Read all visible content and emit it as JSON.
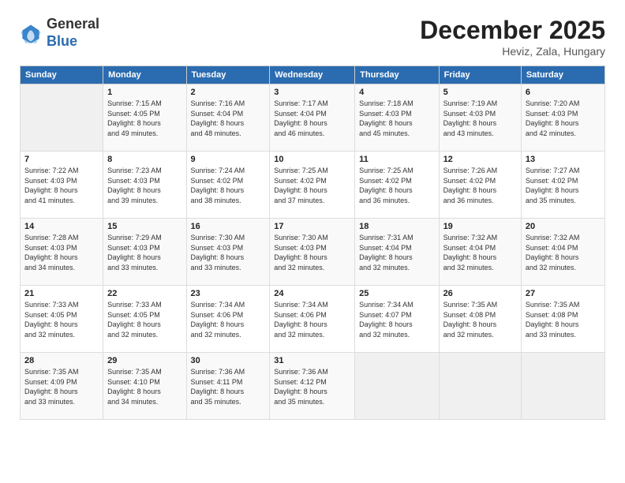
{
  "header": {
    "logo_line1": "General",
    "logo_line2": "Blue",
    "month": "December 2025",
    "location": "Heviz, Zala, Hungary"
  },
  "columns": [
    "Sunday",
    "Monday",
    "Tuesday",
    "Wednesday",
    "Thursday",
    "Friday",
    "Saturday"
  ],
  "weeks": [
    [
      {
        "day": "",
        "info": ""
      },
      {
        "day": "1",
        "info": "Sunrise: 7:15 AM\nSunset: 4:05 PM\nDaylight: 8 hours\nand 49 minutes."
      },
      {
        "day": "2",
        "info": "Sunrise: 7:16 AM\nSunset: 4:04 PM\nDaylight: 8 hours\nand 48 minutes."
      },
      {
        "day": "3",
        "info": "Sunrise: 7:17 AM\nSunset: 4:04 PM\nDaylight: 8 hours\nand 46 minutes."
      },
      {
        "day": "4",
        "info": "Sunrise: 7:18 AM\nSunset: 4:03 PM\nDaylight: 8 hours\nand 45 minutes."
      },
      {
        "day": "5",
        "info": "Sunrise: 7:19 AM\nSunset: 4:03 PM\nDaylight: 8 hours\nand 43 minutes."
      },
      {
        "day": "6",
        "info": "Sunrise: 7:20 AM\nSunset: 4:03 PM\nDaylight: 8 hours\nand 42 minutes."
      }
    ],
    [
      {
        "day": "7",
        "info": "Sunrise: 7:22 AM\nSunset: 4:03 PM\nDaylight: 8 hours\nand 41 minutes."
      },
      {
        "day": "8",
        "info": "Sunrise: 7:23 AM\nSunset: 4:03 PM\nDaylight: 8 hours\nand 39 minutes."
      },
      {
        "day": "9",
        "info": "Sunrise: 7:24 AM\nSunset: 4:02 PM\nDaylight: 8 hours\nand 38 minutes."
      },
      {
        "day": "10",
        "info": "Sunrise: 7:25 AM\nSunset: 4:02 PM\nDaylight: 8 hours\nand 37 minutes."
      },
      {
        "day": "11",
        "info": "Sunrise: 7:25 AM\nSunset: 4:02 PM\nDaylight: 8 hours\nand 36 minutes."
      },
      {
        "day": "12",
        "info": "Sunrise: 7:26 AM\nSunset: 4:02 PM\nDaylight: 8 hours\nand 36 minutes."
      },
      {
        "day": "13",
        "info": "Sunrise: 7:27 AM\nSunset: 4:02 PM\nDaylight: 8 hours\nand 35 minutes."
      }
    ],
    [
      {
        "day": "14",
        "info": "Sunrise: 7:28 AM\nSunset: 4:03 PM\nDaylight: 8 hours\nand 34 minutes."
      },
      {
        "day": "15",
        "info": "Sunrise: 7:29 AM\nSunset: 4:03 PM\nDaylight: 8 hours\nand 33 minutes."
      },
      {
        "day": "16",
        "info": "Sunrise: 7:30 AM\nSunset: 4:03 PM\nDaylight: 8 hours\nand 33 minutes."
      },
      {
        "day": "17",
        "info": "Sunrise: 7:30 AM\nSunset: 4:03 PM\nDaylight: 8 hours\nand 32 minutes."
      },
      {
        "day": "18",
        "info": "Sunrise: 7:31 AM\nSunset: 4:04 PM\nDaylight: 8 hours\nand 32 minutes."
      },
      {
        "day": "19",
        "info": "Sunrise: 7:32 AM\nSunset: 4:04 PM\nDaylight: 8 hours\nand 32 minutes."
      },
      {
        "day": "20",
        "info": "Sunrise: 7:32 AM\nSunset: 4:04 PM\nDaylight: 8 hours\nand 32 minutes."
      }
    ],
    [
      {
        "day": "21",
        "info": "Sunrise: 7:33 AM\nSunset: 4:05 PM\nDaylight: 8 hours\nand 32 minutes."
      },
      {
        "day": "22",
        "info": "Sunrise: 7:33 AM\nSunset: 4:05 PM\nDaylight: 8 hours\nand 32 minutes."
      },
      {
        "day": "23",
        "info": "Sunrise: 7:34 AM\nSunset: 4:06 PM\nDaylight: 8 hours\nand 32 minutes."
      },
      {
        "day": "24",
        "info": "Sunrise: 7:34 AM\nSunset: 4:06 PM\nDaylight: 8 hours\nand 32 minutes."
      },
      {
        "day": "25",
        "info": "Sunrise: 7:34 AM\nSunset: 4:07 PM\nDaylight: 8 hours\nand 32 minutes."
      },
      {
        "day": "26",
        "info": "Sunrise: 7:35 AM\nSunset: 4:08 PM\nDaylight: 8 hours\nand 32 minutes."
      },
      {
        "day": "27",
        "info": "Sunrise: 7:35 AM\nSunset: 4:08 PM\nDaylight: 8 hours\nand 33 minutes."
      }
    ],
    [
      {
        "day": "28",
        "info": "Sunrise: 7:35 AM\nSunset: 4:09 PM\nDaylight: 8 hours\nand 33 minutes."
      },
      {
        "day": "29",
        "info": "Sunrise: 7:35 AM\nSunset: 4:10 PM\nDaylight: 8 hours\nand 34 minutes."
      },
      {
        "day": "30",
        "info": "Sunrise: 7:36 AM\nSunset: 4:11 PM\nDaylight: 8 hours\nand 35 minutes."
      },
      {
        "day": "31",
        "info": "Sunrise: 7:36 AM\nSunset: 4:12 PM\nDaylight: 8 hours\nand 35 minutes."
      },
      {
        "day": "",
        "info": ""
      },
      {
        "day": "",
        "info": ""
      },
      {
        "day": "",
        "info": ""
      }
    ]
  ]
}
